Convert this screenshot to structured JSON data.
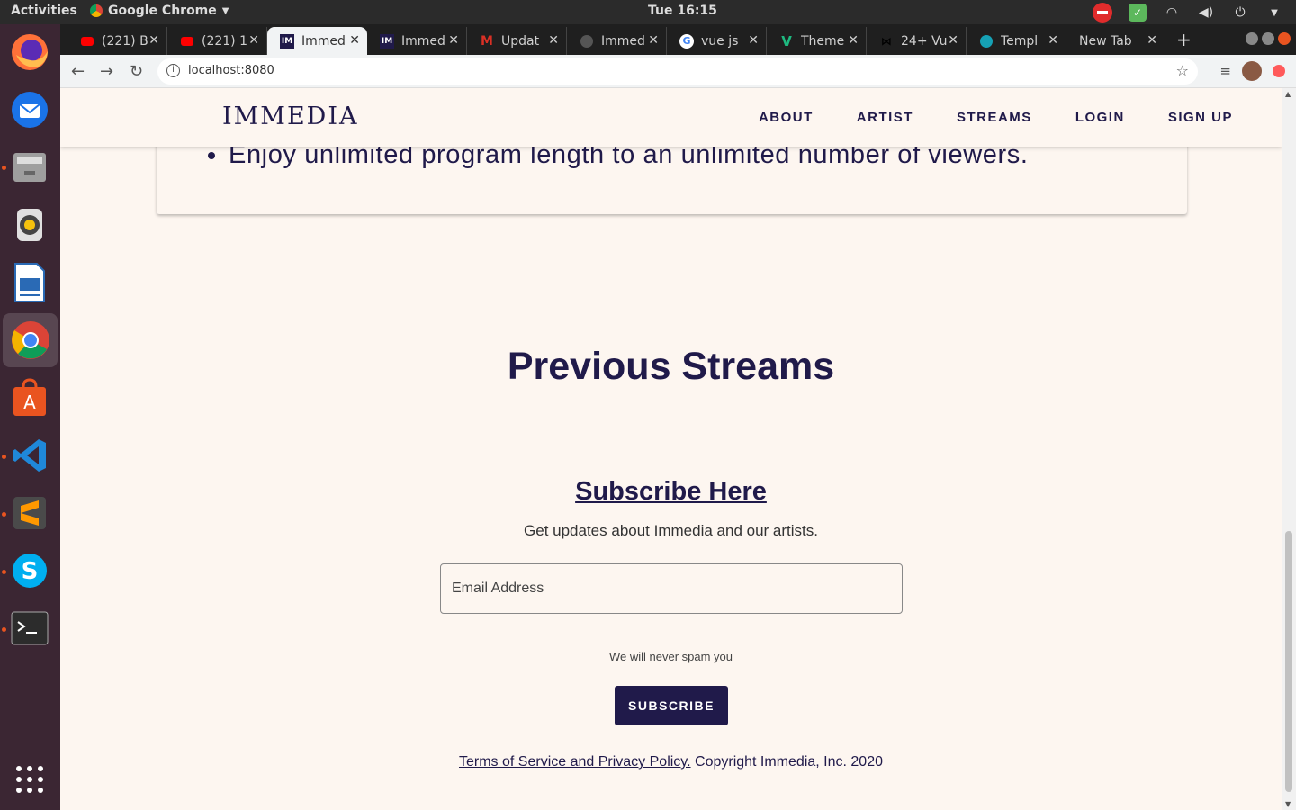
{
  "system": {
    "activities": "Activities",
    "app_menu": "Google Chrome",
    "clock": "Tue 16:15"
  },
  "dock": {
    "apps": [
      "firefox-icon",
      "thunderbird-icon",
      "files-icon",
      "rhythmbox-icon",
      "libreoffice-writer-icon",
      "chrome-icon",
      "software-center-icon",
      "vscode-icon",
      "sublime-text-icon",
      "skype-icon",
      "terminal-icon",
      "show-apps-icon"
    ]
  },
  "browser": {
    "tabs": [
      {
        "title": "(221) B",
        "favicon": "youtube-icon",
        "active": false
      },
      {
        "title": "(221) 1",
        "favicon": "youtube-icon",
        "active": false
      },
      {
        "title": "Immed",
        "favicon": "immedia-icon",
        "active": true
      },
      {
        "title": "Immed",
        "favicon": "immedia-icon",
        "active": false
      },
      {
        "title": "Updat",
        "favicon": "gmail-icon",
        "active": false
      },
      {
        "title": "Immed",
        "favicon": "github-icon",
        "active": false
      },
      {
        "title": "vue js",
        "favicon": "google-icon",
        "active": false
      },
      {
        "title": "Theme",
        "favicon": "vuetify-icon",
        "active": false
      },
      {
        "title": "24+ Vu",
        "favicon": "generic-icon",
        "active": false
      },
      {
        "title": "Templ",
        "favicon": "template-icon",
        "active": false
      },
      {
        "title": "New Tab",
        "favicon": "",
        "active": false
      }
    ],
    "url": "localhost:8080"
  },
  "site": {
    "logo": "IMMEDIA",
    "nav": [
      "ABOUT",
      "ARTIST",
      "STREAMS",
      "LOGIN",
      "SIGN UP"
    ],
    "card_bullet": "Enjoy unlimited program length to an unlimited number of viewers.",
    "previous_streams": "Previous Streams",
    "subscribe_heading": "Subscribe Here",
    "subscribe_text": "Get updates about Immedia and our artists.",
    "email_placeholder": "Email Address",
    "no_spam": "We will never spam you",
    "subscribe_button": "SUBSCRIBE",
    "footer_link": "Terms of Service and Privacy Policy.",
    "footer_copyright": " Copyright Immedia, Inc. 2020"
  },
  "colors": {
    "brand": "#201a4a",
    "page_bg": "#fdf6f0"
  }
}
